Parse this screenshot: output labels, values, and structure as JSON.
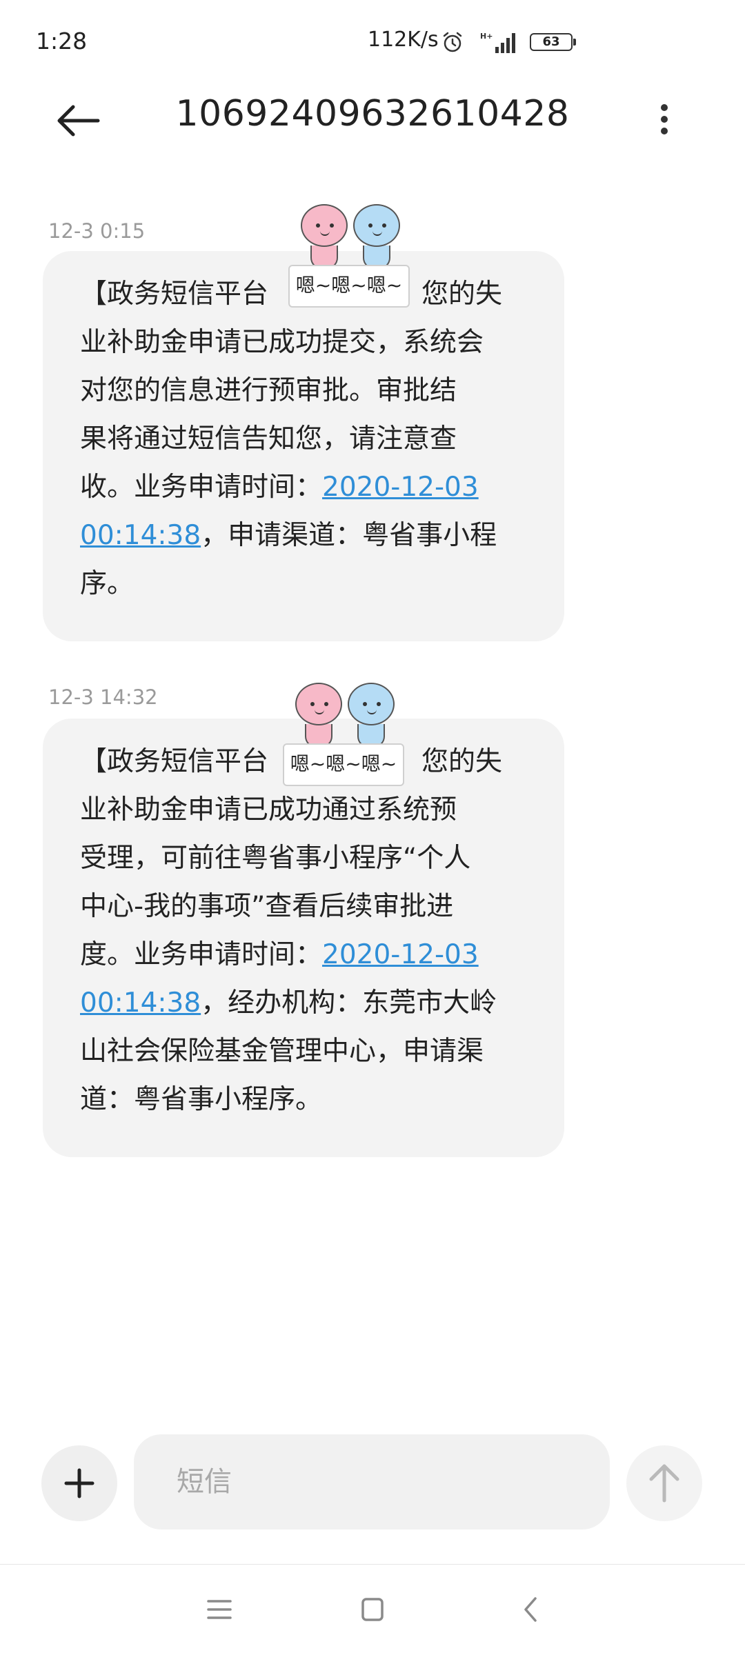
{
  "status_bar": {
    "time": "1:28",
    "network_speed": "112K/s",
    "signal_label": "H+",
    "battery": "63"
  },
  "header": {
    "contact": "10692409632610428"
  },
  "messages": [
    {
      "timestamp": "12-3 0:15",
      "lines": [
        "【政务短信平台",
        "您的失",
        "业补助金申请已成功提交，系统会",
        "对您的信息进行预审批。审批结",
        "果将通过短信告知您，请注意查",
        "收。业务申请时间："
      ],
      "link_part1": "2020-12-03",
      "link_part2": "00:14:38",
      "after_link": "，申请渠道：粤省事小程",
      "last_line": "序。"
    },
    {
      "timestamp": "12-3 14:32",
      "lines": [
        "【政务短信平台",
        "您的失",
        "业补助金申请已成功通过系统预",
        "受理，可前往粤省事小程序“个人",
        "中心-我的事项”查看后续审批进",
        "度。业务申请时间："
      ],
      "link_part1": "2020-12-03",
      "link_part2": "00:14:38",
      "after_link": "，经办机构：东莞市大岭",
      "line_8": "山社会保险基金管理中心，申请渠",
      "last_line": "道：粤省事小程序。"
    }
  ],
  "sticker": {
    "text": "嗯~嗯~嗯~"
  },
  "composer": {
    "placeholder": "短信"
  },
  "icons": {
    "back": "arrow-left-icon",
    "more": "more-vertical-icon",
    "add": "plus-icon",
    "send": "arrow-up-icon",
    "alarm": "alarm-clock-icon",
    "signal": "cellular-signal-icon"
  }
}
